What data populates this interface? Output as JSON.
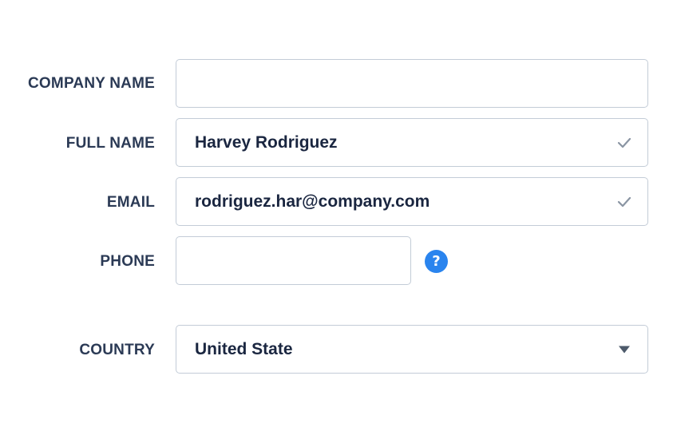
{
  "form": {
    "company": {
      "label": "COMPANY NAME",
      "value": "",
      "placeholder": ""
    },
    "full_name": {
      "label": "FULL NAME",
      "value": "Harvey Rodriguez",
      "placeholder": "",
      "valid": true
    },
    "email": {
      "label": "EMAIL",
      "value": "rodriguez.har@company.com",
      "placeholder": "",
      "valid": true
    },
    "phone": {
      "label": "PHONE",
      "value": "",
      "placeholder": "",
      "help_icon": "question-mark",
      "help_glyph": "?"
    },
    "country": {
      "label": "COUNTRY",
      "value": "United State",
      "icon": "caret-down"
    }
  },
  "colors": {
    "label": "#2b3a55",
    "value_text": "#1a2640",
    "border": "#c3ccd7",
    "check": "#8a95a3",
    "help_accent": "#2a84ee"
  }
}
